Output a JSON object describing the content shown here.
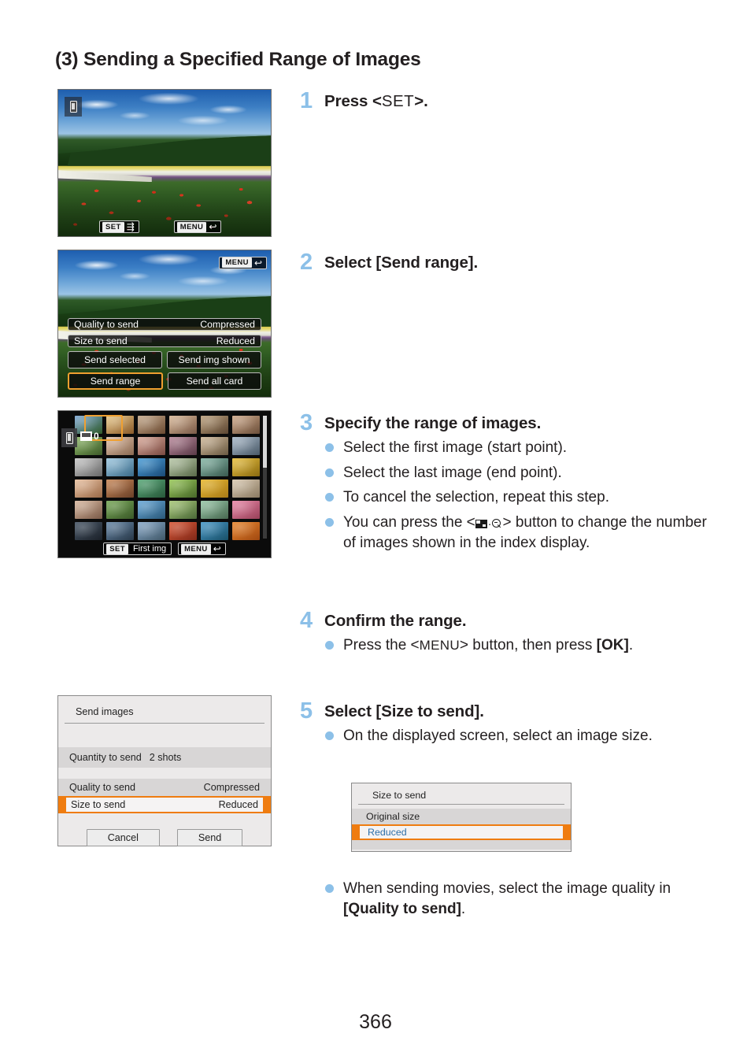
{
  "page": {
    "heading": "(3) Sending a Specified Range of Images",
    "number": "366"
  },
  "screenshots": {
    "playback": {
      "name": "playback-image-screen",
      "phone_icon": "smartphone-icon",
      "set_key": "SET",
      "set_action_icon": "send-to-device-icon",
      "menu_key": "MENU",
      "menu_action_icon": "return-arrow-icon"
    },
    "send_options": {
      "name": "send-options-screen",
      "menu_key": "MENU",
      "menu_action_icon": "return-arrow-icon",
      "rows": [
        {
          "label": "Quality to send",
          "value": "Compressed",
          "selected": false
        },
        {
          "label": "Size to send",
          "value": "Reduced",
          "selected": false
        }
      ],
      "buttons": [
        {
          "label": "Send selected",
          "selected": false
        },
        {
          "label": "Send img shown",
          "selected": false
        },
        {
          "label": "Send range",
          "selected": true
        },
        {
          "label": "Send all card",
          "selected": false
        }
      ]
    },
    "index_display": {
      "name": "index-display-screen",
      "phone_icon": "smartphone-icon",
      "selection_count": "0",
      "set_key": "SET",
      "set_label": "First img",
      "menu_key": "MENU",
      "menu_action_icon": "return-arrow-icon",
      "grid_columns": 6,
      "grid_rows": 6
    },
    "send_images_dialog": {
      "name": "send-images-dialog",
      "title": "Send images",
      "quantity_label": "Quantity to send",
      "quantity_value": "2 shots",
      "rows": [
        {
          "label": "Quality to send",
          "value": "Compressed",
          "selected": false
        },
        {
          "label": "Size to send",
          "value": "Reduced",
          "selected": true
        }
      ],
      "cancel_label": "Cancel",
      "send_label": "Send"
    },
    "size_to_send_dialog": {
      "name": "size-to-send-dialog",
      "title": "Size to send",
      "options": [
        {
          "label": "Original size",
          "selected": false
        },
        {
          "label": "Reduced",
          "selected": true
        }
      ]
    }
  },
  "steps": [
    {
      "number": "1",
      "title_prefix": "Press <",
      "title_key": "SET",
      "title_suffix": ">.",
      "bullets": []
    },
    {
      "number": "2",
      "title": "Select [Send range].",
      "bullets": []
    },
    {
      "number": "3",
      "title": "Specify the range of images.",
      "bullets": [
        "Select the first image (start point).",
        "Select the last image (end point).",
        "To cancel the selection, repeat this step."
      ],
      "bullet_with_icon": {
        "before": "You can press the <",
        "icon": "index-magnify-icon",
        "after": "> button to change the number of images shown in the index display."
      }
    },
    {
      "number": "4",
      "title": "Confirm the range.",
      "bullet_menu": {
        "before": "Press the <",
        "key": "MENU",
        "middle": "> button, then press ",
        "bold": "[OK]",
        "after": "."
      }
    },
    {
      "number": "5",
      "title": "Select [Size to send].",
      "bullets": [
        "On the displayed screen, select an image size."
      ],
      "closing_bullet": {
        "before": "When sending movies, select the image quality in ",
        "bold": "[Quality to send]",
        "after": "."
      }
    }
  ],
  "colors": {
    "step_number": "#8cc0e8",
    "bullet_dot": "#8cc0e8",
    "selection_orange": "#ef7c10",
    "camera_highlight": "#f0a030",
    "text": "#231f20"
  }
}
